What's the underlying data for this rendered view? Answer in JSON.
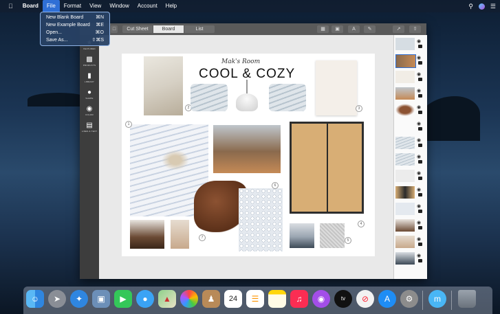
{
  "menubar": {
    "apple": "",
    "app_name": "Board",
    "items": [
      "File",
      "Format",
      "View",
      "Window",
      "Account",
      "Help"
    ]
  },
  "file_menu": [
    {
      "label": "New Blank Board",
      "shortcut": "⌘N"
    },
    {
      "label": "New Example Board",
      "shortcut": "⌘E"
    },
    {
      "label": "Open...",
      "shortcut": "⌘O"
    },
    {
      "label": "Save As...",
      "shortcut": "⇧⌘S"
    }
  ],
  "toolbar": {
    "views": [
      "Cut Sheet",
      "Board",
      "List"
    ],
    "active_view": "Board"
  },
  "sidebar": {
    "tools": [
      "FEATURED",
      "PRODUCTS",
      "LIBRARY",
      "SHAPE",
      "COLOR",
      "LINES & TEXT"
    ]
  },
  "board": {
    "subtitle": "Mak's Room",
    "title": "COOL & COZY",
    "numbers": [
      "1",
      "2",
      "3",
      "4",
      "5",
      "6",
      "7"
    ]
  },
  "dock": {
    "calendar_day": "24"
  }
}
